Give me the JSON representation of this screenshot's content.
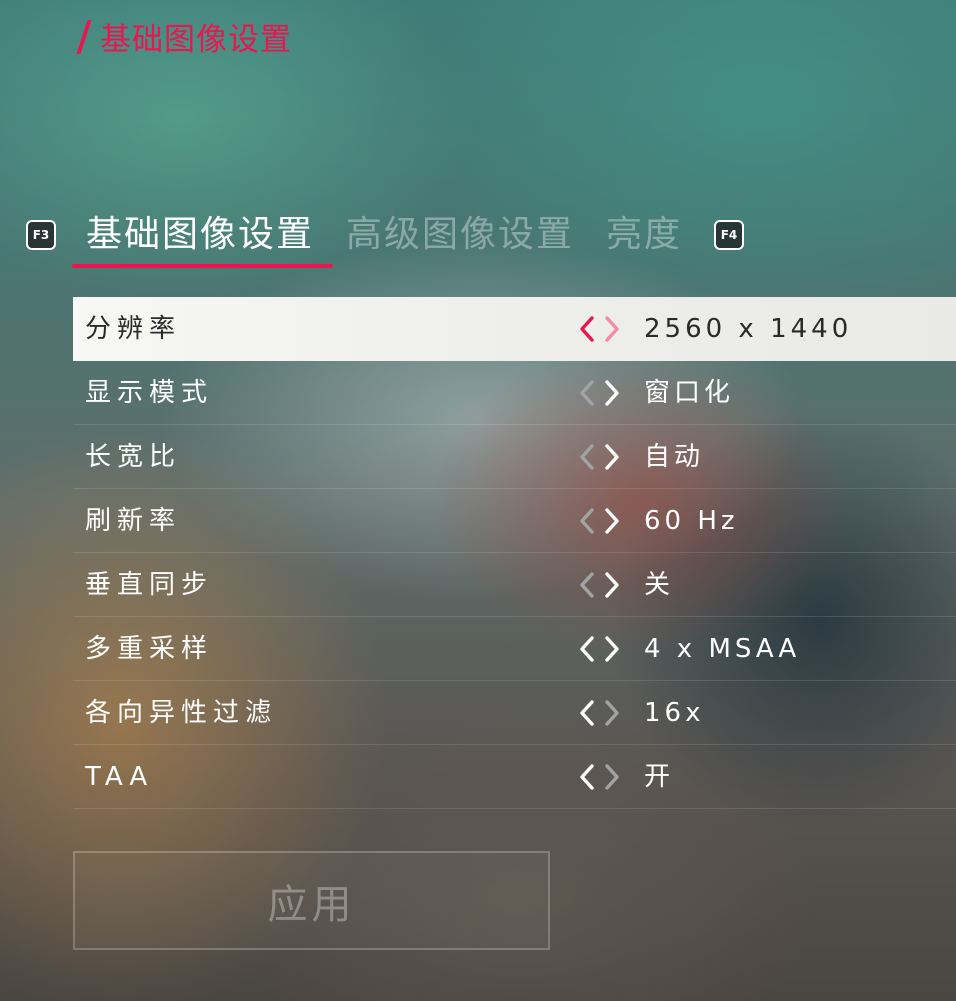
{
  "page_title": "基础图像设置",
  "tabs": {
    "prev_key": "F3",
    "next_key": "F4",
    "items": [
      {
        "label": "基础图像设置",
        "active": true
      },
      {
        "label": "高级图像设置",
        "active": false
      },
      {
        "label": "亮度",
        "active": false
      }
    ]
  },
  "settings": [
    {
      "label": "分辨率",
      "value": "2560 x 1440",
      "selected": true
    },
    {
      "label": "显示模式",
      "value": "窗口化",
      "selected": false
    },
    {
      "label": "长宽比",
      "value": "自动",
      "selected": false
    },
    {
      "label": "刷新率",
      "value": "60 Hz",
      "selected": false
    },
    {
      "label": "垂直同步",
      "value": "关",
      "selected": false
    },
    {
      "label": "多重采样",
      "value": "4 x MSAA",
      "selected": false
    },
    {
      "label": "各向异性过滤",
      "value": "16x",
      "selected": false
    },
    {
      "label": "TAA",
      "value": "开",
      "selected": false
    }
  ],
  "apply_label": "应用",
  "colors": {
    "accent": "#e8174f",
    "arrow_active": "#ffffff",
    "arrow_dim": "#a0a4a4",
    "arrow_selected_left": "#e8174f",
    "arrow_selected_right": "#f48aa4"
  },
  "icons": {
    "arrow_left": "chevron-left-icon",
    "arrow_right": "chevron-right-icon"
  }
}
